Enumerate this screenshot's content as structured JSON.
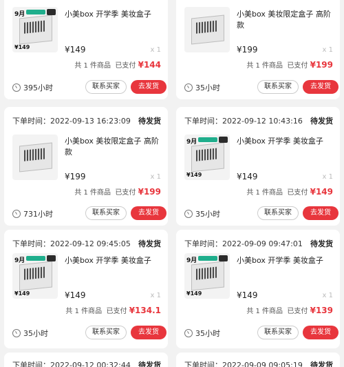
{
  "common": {
    "item_count": "共 1 件商品",
    "paid_label": "已支付",
    "contact_button": "联系买家",
    "ship_button": "去发货",
    "thumb_month": "9月",
    "thumb_price": "¥149"
  },
  "orders": [
    {
      "time": "",
      "status": "",
      "title": "小美box 开学季 美妆盒子",
      "price": "¥149",
      "qty": "x 1",
      "paid": "¥144",
      "hours": "395小时",
      "thumb": "colored"
    },
    {
      "time": "",
      "status": "",
      "title": "小美box 美妆限定盒子 高阶款",
      "price": "¥199",
      "qty": "x 1",
      "paid": "¥199",
      "hours": "35小时",
      "thumb": "plain"
    },
    {
      "time": "下单时间：2022-09-13 16:23:09",
      "status": "待发货",
      "title": "小美box 美妆限定盒子 高阶款",
      "price": "¥199",
      "qty": "x 1",
      "paid": "¥199",
      "hours": "731小时",
      "thumb": "plain"
    },
    {
      "time": "下单时间：2022-09-12 10:43:16",
      "status": "待发货",
      "title": "小美box 开学季 美妆盒子",
      "price": "¥149",
      "qty": "x 1",
      "paid": "¥149",
      "hours": "35小时",
      "thumb": "colored"
    },
    {
      "time": "下单时间：2022-09-12 09:45:05",
      "status": "待发货",
      "title": "小美box 开学季 美妆盒子",
      "price": "¥149",
      "qty": "x 1",
      "paid": "¥134.1",
      "hours": "35小时",
      "thumb": "colored"
    },
    {
      "time": "下单时间：2022-09-09 09:47:01",
      "status": "待发货",
      "title": "小美box 开学季 美妆盒子",
      "price": "¥149",
      "qty": "x 1",
      "paid": "¥139",
      "hours": "35小时",
      "thumb": "colored"
    },
    {
      "time": "下单时间：2022-09-12 00:32:44",
      "status": "待发货"
    },
    {
      "time": "下单时间：2022-09-09 09:05:19",
      "status": "待发货"
    }
  ]
}
